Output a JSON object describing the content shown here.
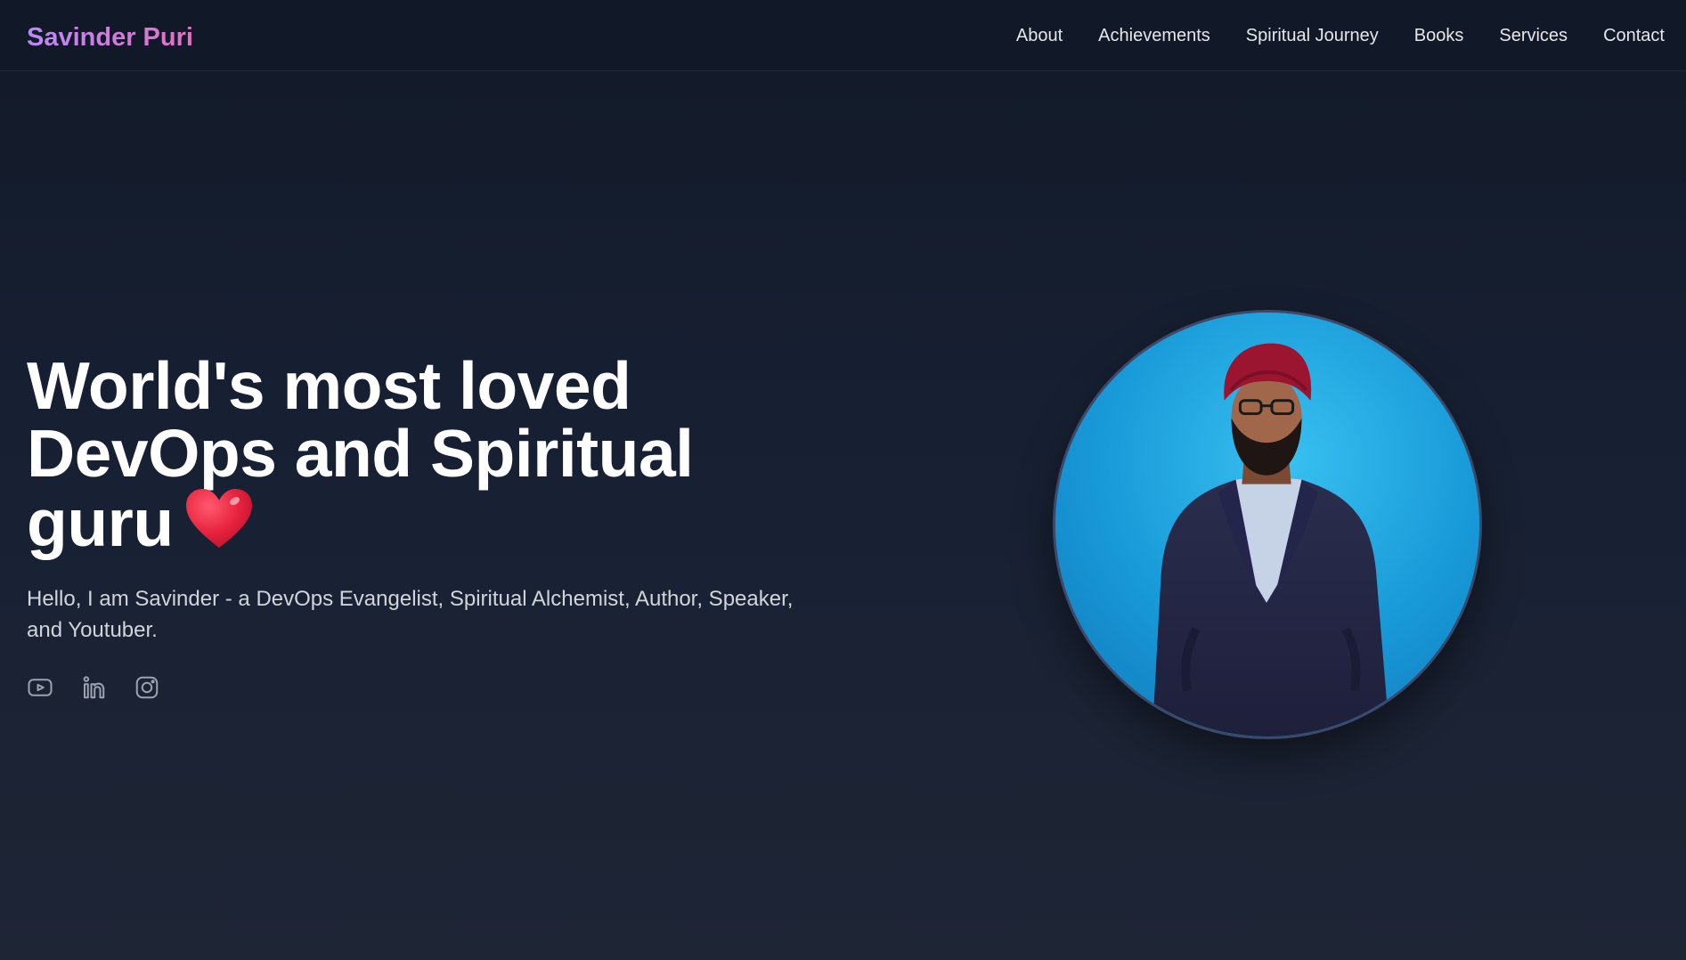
{
  "nav": {
    "brand": "Savinder Puri",
    "links": [
      "About",
      "Achievements",
      "Spiritual Journey",
      "Books",
      "Services",
      "Contact"
    ]
  },
  "hero": {
    "headline_line1": "World's most loved",
    "headline_line2": "DevOps and Spiritual",
    "headline_line3": "guru",
    "headline_emoji": "heart-emoji",
    "subtitle": "Hello, I am Savinder - a DevOps Evangelist, Spiritual Alchemist, Author, Speaker, and Youtuber.",
    "socials": [
      "youtube-icon",
      "linkedin-icon",
      "instagram-icon"
    ],
    "portrait_alt": "portrait-photo"
  },
  "colors": {
    "brand_gradient_start": "#b98af5",
    "brand_gradient_end": "#e36fc3",
    "background": "#172033",
    "heart": "#e8233f",
    "portrait_bg": "#1497d6"
  }
}
